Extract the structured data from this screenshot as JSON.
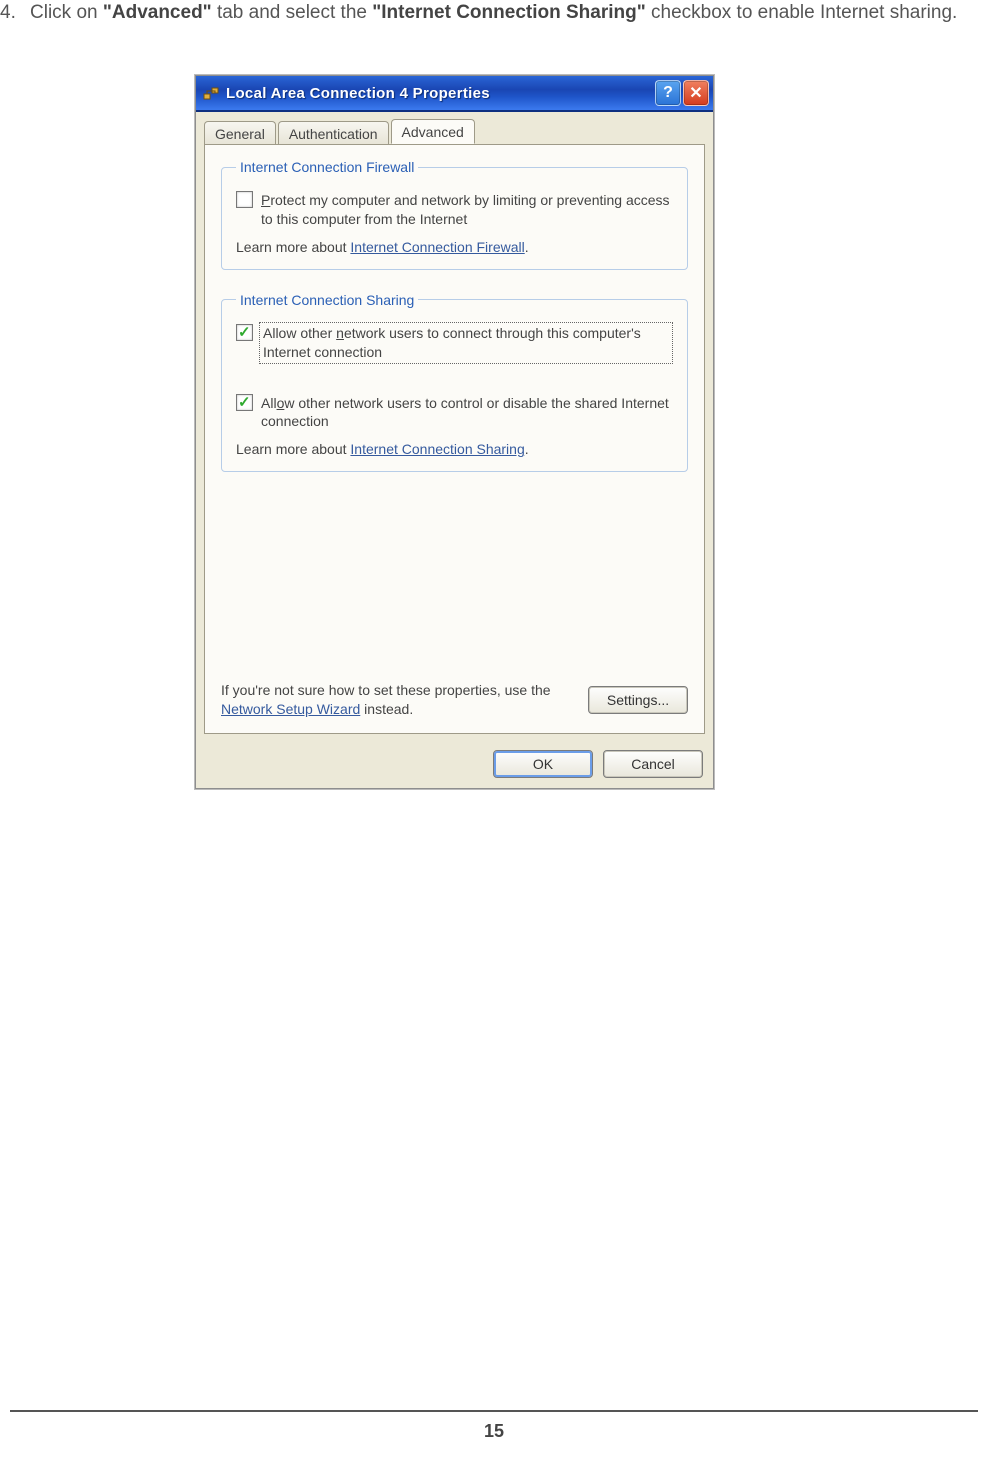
{
  "instruction": {
    "number": "4.",
    "pre_text": "Click on ",
    "bold1": "\"Advanced\"",
    "mid_text": " tab and select the ",
    "bold2": "\"Internet Connection Sharing\"",
    "post_text": " checkbox to enable Internet sharing."
  },
  "dialog": {
    "title": "Local Area Connection 4 Properties",
    "help_glyph": "?",
    "close_glyph": "✕",
    "tabs": {
      "general": "General",
      "authentication": "Authentication",
      "advanced": "Advanced"
    },
    "firewall": {
      "legend": "Internet Connection Firewall",
      "protect_pre": "P",
      "protect_rest": "rotect my computer and network by limiting or preventing access to this computer from the Internet",
      "learn_pre": "Learn more about ",
      "learn_link": "Internet Connection Firewall",
      "learn_post": "."
    },
    "sharing": {
      "legend": "Internet Connection Sharing",
      "allow1_pre": "Allow other ",
      "allow1_u": "n",
      "allow1_rest": "etwork users to connect through this computer's Internet connection",
      "allow2_pre": "All",
      "allow2_u": "o",
      "allow2_rest": "w other network users to control or disable the shared Internet connection",
      "learn_pre": "Learn more about ",
      "learn_link": "Internet Connection Sharing",
      "learn_post": "."
    },
    "wizard": {
      "note_pre": "If you're not sure how to set these properties, use the ",
      "note_link": "Network Setup Wizard",
      "note_post": " instead.",
      "settings_btn": "Settings..."
    },
    "buttons": {
      "ok": "OK",
      "cancel": "Cancel"
    }
  },
  "page_number": "15"
}
